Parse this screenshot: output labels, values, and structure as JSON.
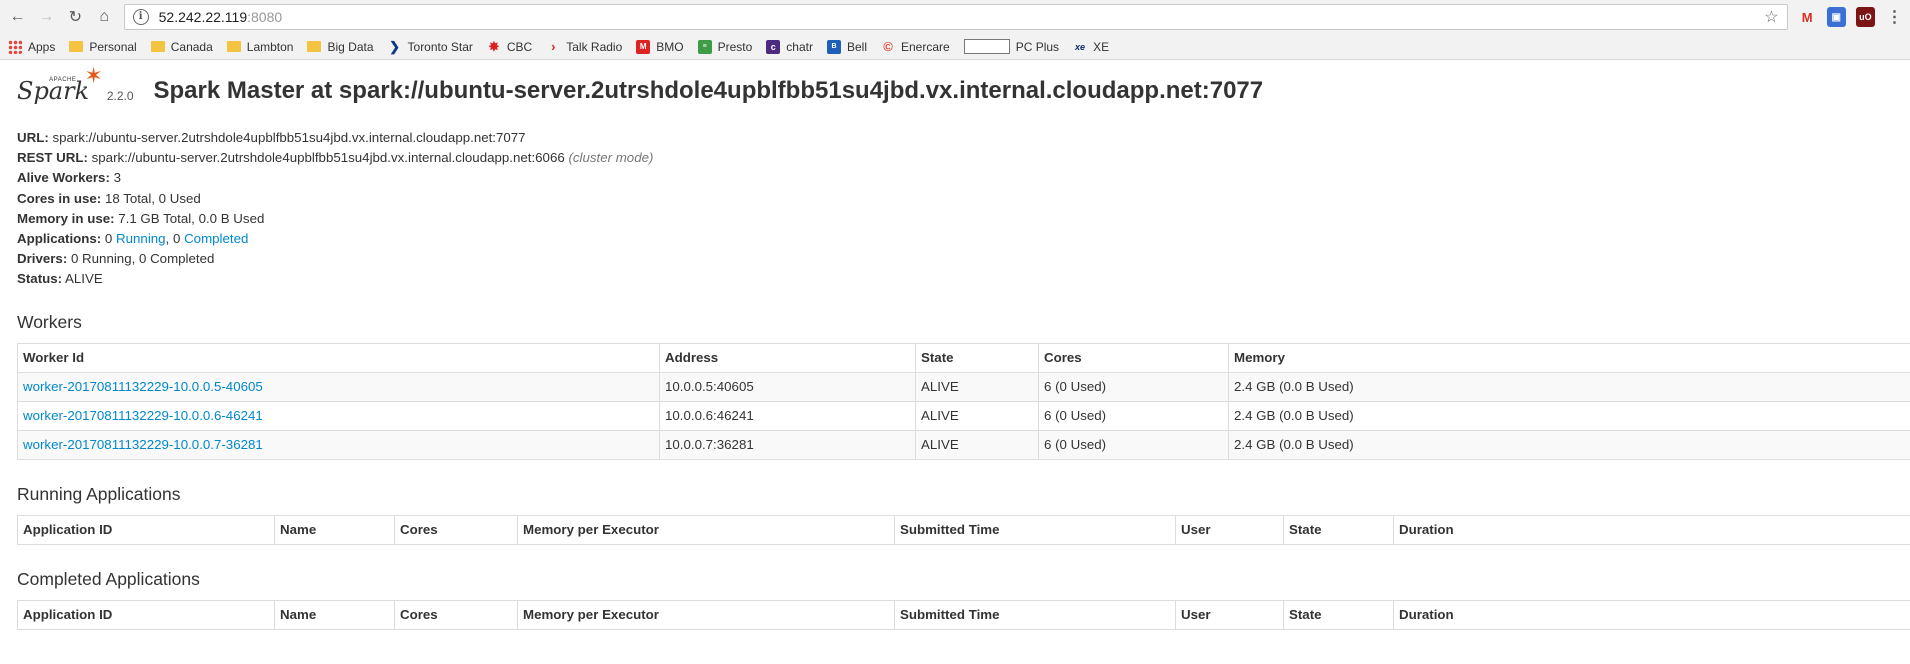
{
  "browser": {
    "url_host": "52.242.22.119",
    "url_port": ":8080",
    "bookmarks": [
      {
        "icon": "apps-grid-icon",
        "cls": "grid",
        "glyph": "",
        "label": "Apps"
      },
      {
        "icon": "folder-icon",
        "cls": "folder",
        "glyph": "",
        "label": "Personal"
      },
      {
        "icon": "folder-icon",
        "cls": "folder",
        "glyph": "",
        "label": "Canada"
      },
      {
        "icon": "folder-icon",
        "cls": "folder",
        "glyph": "",
        "label": "Lambton"
      },
      {
        "icon": "folder-icon",
        "cls": "folder",
        "glyph": "",
        "label": "Big Data"
      },
      {
        "icon": "toronto-star-icon",
        "cls": "ts",
        "glyph": "❯",
        "label": "Toronto Star"
      },
      {
        "icon": "cbc-icon",
        "cls": "cbc",
        "glyph": "✸",
        "label": "CBC"
      },
      {
        "icon": "talk-radio-icon",
        "cls": "talk",
        "glyph": "›",
        "label": "Talk Radio"
      },
      {
        "icon": "bmo-icon",
        "cls": "bmo",
        "glyph": "M",
        "label": "BMO"
      },
      {
        "icon": "presto-icon",
        "cls": "presto",
        "glyph": "≡",
        "label": "Presto"
      },
      {
        "icon": "chatr-icon",
        "cls": "chatr",
        "glyph": "c",
        "label": "chatr"
      },
      {
        "icon": "bell-icon",
        "cls": "bell",
        "glyph": "B",
        "label": "Bell"
      },
      {
        "icon": "enercare-icon",
        "cls": "ener",
        "glyph": "©",
        "label": "Enercare"
      },
      {
        "icon": "page-icon",
        "cls": "page",
        "glyph": "",
        "label": "PC Plus"
      },
      {
        "icon": "xe-icon",
        "cls": "xe",
        "glyph": "xe",
        "label": "XE"
      }
    ]
  },
  "header": {
    "logo_text": "Spark",
    "logo_apache": "APACHE",
    "version": "2.2.0",
    "title": "Spark Master at spark://ubuntu-server.2utrshdole4upblfbb51su4jbd.vx.internal.cloudapp.net:7077"
  },
  "summary": {
    "url_label": "URL:",
    "url_value": "spark://ubuntu-server.2utrshdole4upblfbb51su4jbd.vx.internal.cloudapp.net:7077",
    "rest_label": "REST URL:",
    "rest_value": "spark://ubuntu-server.2utrshdole4upblfbb51su4jbd.vx.internal.cloudapp.net:6066",
    "rest_mode": "(cluster mode)",
    "workers_label": "Alive Workers:",
    "workers_value": "3",
    "cores_label": "Cores in use:",
    "cores_value": "18 Total, 0 Used",
    "memory_label": "Memory in use:",
    "memory_value": "7.1 GB Total, 0.0 B Used",
    "apps_label": "Applications:",
    "apps_running_count": "0",
    "apps_running_link": "Running",
    "apps_sep": ", 0",
    "apps_completed_link": "Completed",
    "drivers_label": "Drivers:",
    "drivers_value": "0 Running, 0 Completed",
    "status_label": "Status:",
    "status_value": "ALIVE"
  },
  "workers": {
    "title": "Workers",
    "columns": [
      "Worker Id",
      "Address",
      "State",
      "Cores",
      "Memory"
    ],
    "rows": [
      [
        "worker-20170811132229-10.0.0.5-40605",
        "10.0.0.5:40605",
        "ALIVE",
        "6 (0 Used)",
        "2.4 GB (0.0 B Used)"
      ],
      [
        "worker-20170811132229-10.0.0.6-46241",
        "10.0.0.6:46241",
        "ALIVE",
        "6 (0 Used)",
        "2.4 GB (0.0 B Used)"
      ],
      [
        "worker-20170811132229-10.0.0.7-36281",
        "10.0.0.7:36281",
        "ALIVE",
        "6 (0 Used)",
        "2.4 GB (0.0 B Used)"
      ]
    ]
  },
  "running": {
    "title": "Running Applications",
    "columns": [
      "Application ID",
      "Name",
      "Cores",
      "Memory per Executor",
      "Submitted Time",
      "User",
      "State",
      "Duration"
    ]
  },
  "completed": {
    "title": "Completed Applications",
    "columns": [
      "Application ID",
      "Name",
      "Cores",
      "Memory per Executor",
      "Submitted Time",
      "User",
      "State",
      "Duration"
    ]
  }
}
